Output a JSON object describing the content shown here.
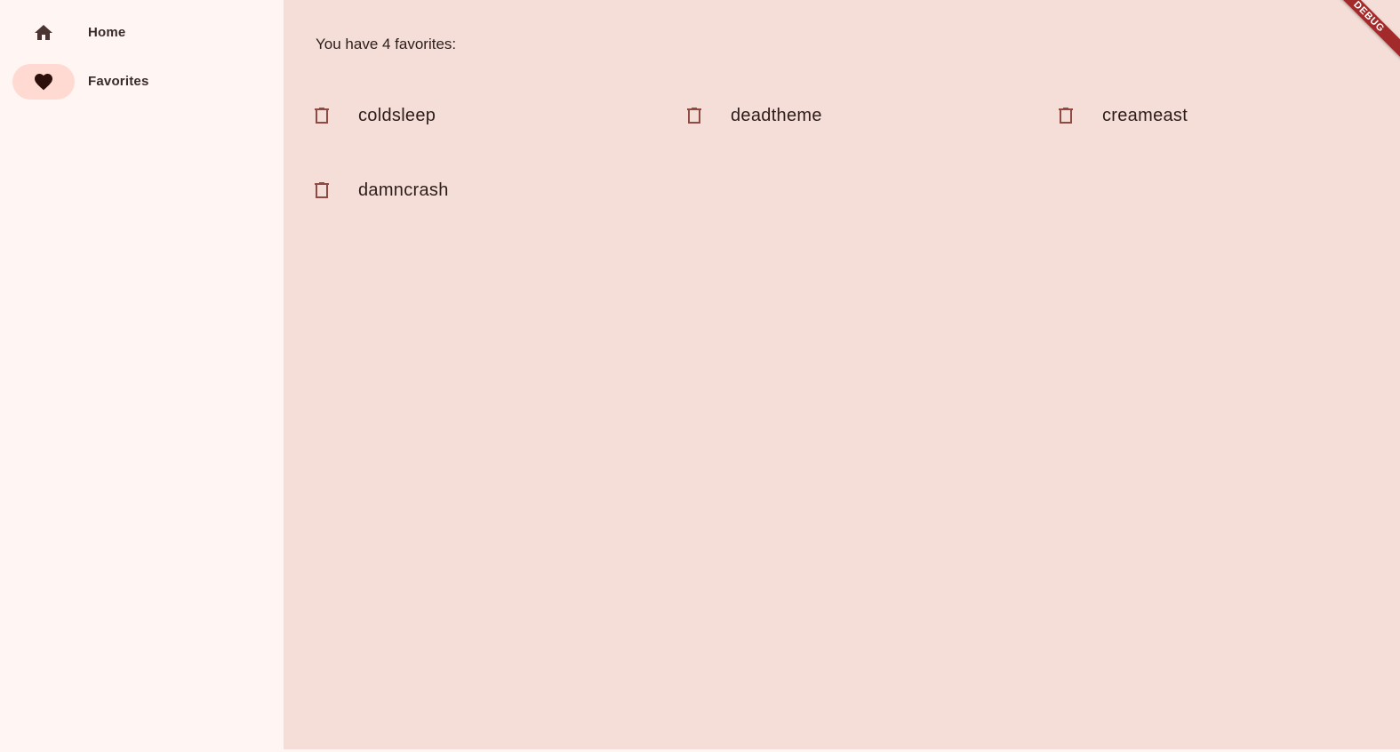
{
  "nav": {
    "items": [
      {
        "label": "Home",
        "icon": "home-icon",
        "selected": false
      },
      {
        "label": "Favorites",
        "icon": "heart-icon",
        "selected": true
      }
    ]
  },
  "favorites_page": {
    "headline": "You have 4 favorites:",
    "items": [
      "coldsleep",
      "deadtheme",
      "creameast",
      "damncrash"
    ]
  },
  "debug_banner": "DEBUG",
  "colors": {
    "rail_background": "#fff6f4",
    "content_background": "#f5ded8",
    "selected_indicator": "#ffdad2",
    "delete_icon": "#904a42",
    "debug_banner": "#a32a2a"
  }
}
